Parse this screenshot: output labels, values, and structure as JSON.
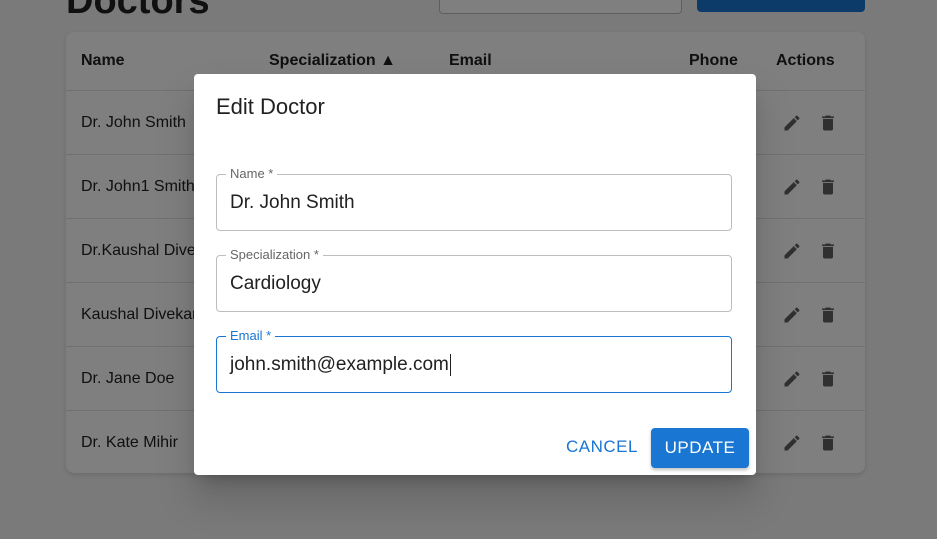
{
  "page": {
    "title": "Doctors",
    "add_button_label": ""
  },
  "table": {
    "headers": {
      "name": "Name",
      "specialization": "Specialization ▲",
      "email": "Email",
      "phone": "Phone",
      "actions": "Actions"
    },
    "rows": [
      {
        "name": "Dr. John Smith"
      },
      {
        "name": "Dr. John1 Smith"
      },
      {
        "name": "Dr.Kaushal Divekar"
      },
      {
        "name": "Kaushal Divekar"
      },
      {
        "name": "Dr. Jane Doe"
      },
      {
        "name": "Dr. Kate Mihir"
      }
    ],
    "icons": {
      "edit": "pencil-edit-icon",
      "delete": "trash-delete-icon"
    },
    "icon_color": "#616161"
  },
  "dialog": {
    "title": "Edit Doctor",
    "fields": {
      "name": {
        "label": "Name *",
        "value": "Dr. John Smith"
      },
      "specialization": {
        "label": "Specialization *",
        "value": "Cardiology"
      },
      "email": {
        "label": "Email *",
        "value": "john.smith@example.com"
      }
    },
    "cancel_label": "CANCEL",
    "update_label": "UPDATE"
  },
  "colors": {
    "primary": "#1976d2",
    "overlay": "rgba(0,0,0,0.5)"
  }
}
